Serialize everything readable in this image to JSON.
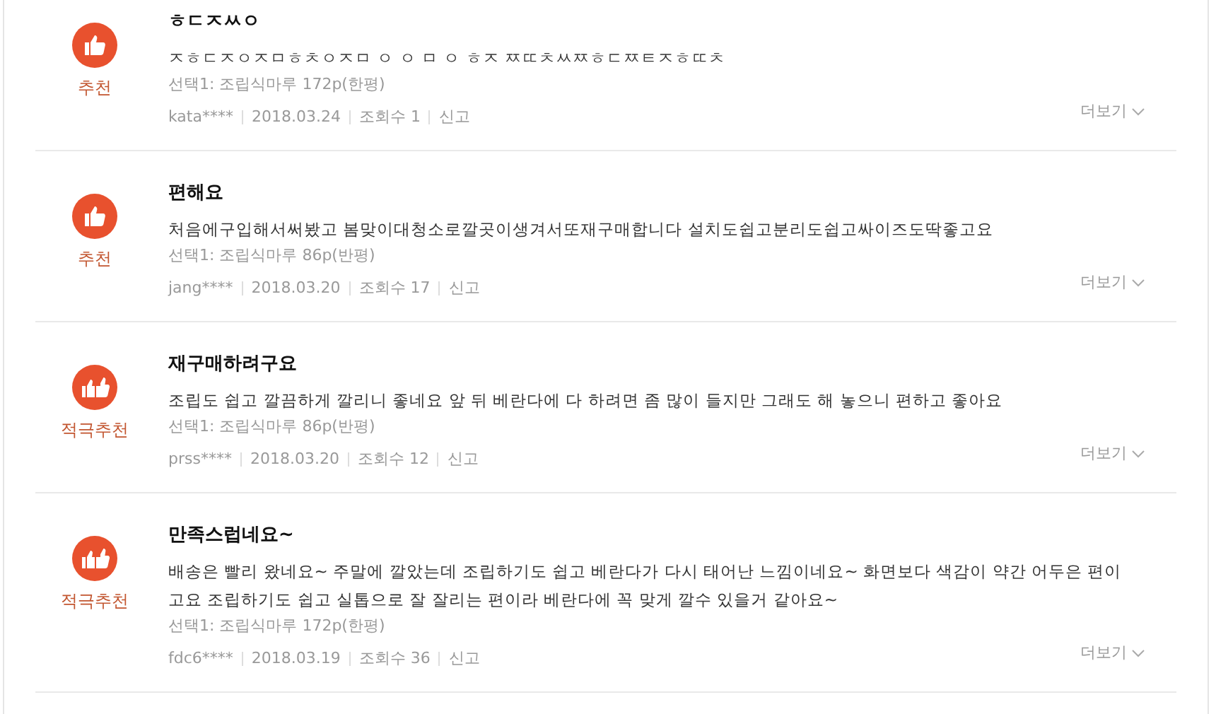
{
  "reviews": [
    {
      "kind": "recommend",
      "badge": "추천",
      "title": "ㅎㄷㅈㅆㅇ",
      "body": "ㅈㅎㄷㅈㅇㅈㅁㅎㅊㅇㅈㅁ ㅇ ㅇ ㅁ ㅇ ㅎㅈ ㅉㄸㅊㅆㅉㅎㄷㅉㅌㅈㅎㄸㅊ",
      "option": "선택1: 조립식마루 172p(한평)",
      "user": "kata****",
      "date": "2018.03.24",
      "views": "조회수 1",
      "report": "신고",
      "more": "더보기"
    },
    {
      "kind": "recommend",
      "badge": "추천",
      "title": "편해요",
      "body": "처음에구입해서써봤고 봄맞이대청소로깔곳이생겨서또재구매합니다 설치도쉽고분리도쉽고싸이즈도딱좋고요",
      "option": "선택1: 조립식마루 86p(반평)",
      "user": "jang****",
      "date": "2018.03.20",
      "views": "조회수 17",
      "report": "신고",
      "more": "더보기"
    },
    {
      "kind": "strong",
      "badge": "적극추천",
      "title": "재구매하려구요",
      "body": "조립도 쉽고 깔끔하게 깔리니 좋네요 앞 뒤 베란다에 다 하려면 좀 많이 들지만 그래도 해 놓으니 편하고 좋아요",
      "option": "선택1: 조립식마루 86p(반평)",
      "user": "prss****",
      "date": "2018.03.20",
      "views": "조회수 12",
      "report": "신고",
      "more": "더보기"
    },
    {
      "kind": "strong",
      "badge": "적극추천",
      "title": "만족스럽네요~",
      "body": "배송은 빨리 왔네요~ 주말에 깔았는데 조립하기도 쉽고 베란다가 다시 태어난 느낌이네요~ 화면보다 색감이 약간 어두은 편이고요 조립하기도 쉽고 실톱으로 잘 잘리는 편이라 베란다에 꼭 맞게 깔수 있을거 같아요~",
      "option": "선택1: 조립식마루 172p(한평)",
      "user": "fdc6****",
      "date": "2018.03.19",
      "views": "조회수 36",
      "report": "신고",
      "more": "더보기"
    }
  ]
}
